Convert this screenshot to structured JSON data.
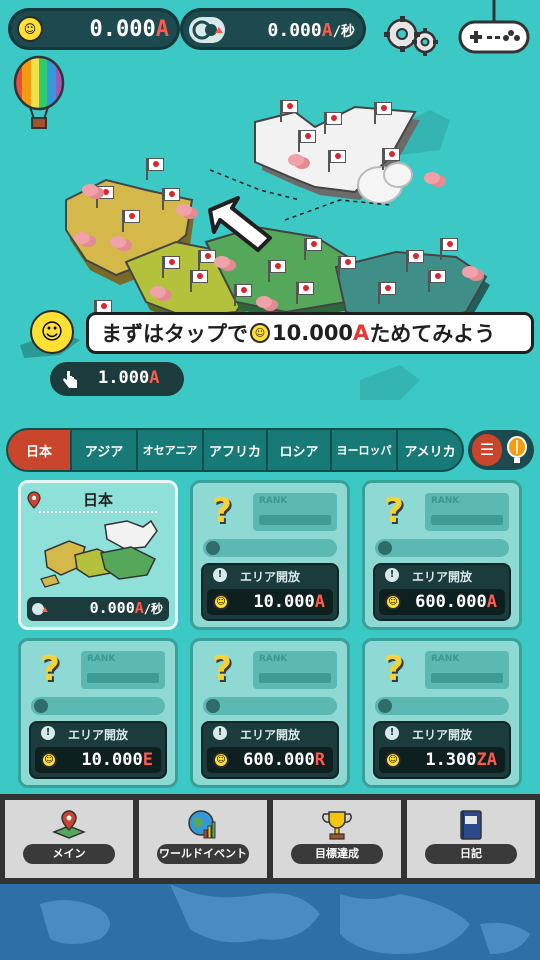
{
  "top_bar": {
    "currency_value": "0.000",
    "currency_unit": "A",
    "rate_value": "0.000",
    "rate_unit": "A",
    "rate_suffix": "/秒"
  },
  "icons": {
    "settings": "gear-icon",
    "gamepad": "gamepad-icon",
    "balloon": "hot-air-balloon-icon",
    "smiley": "smiley-icon"
  },
  "tutorial": {
    "prefix": "まずはタップで",
    "amount": "10.000",
    "amount_unit": "A",
    "suffix": "ためてみよう"
  },
  "tap_value": {
    "value": "1.000",
    "unit": "A"
  },
  "region_tabs": [
    "日本",
    "アジア",
    "オセアニア",
    "アフリカ",
    "ロシア",
    "ヨーロッパ",
    "アメリカ"
  ],
  "active_tab_index": 0,
  "area_cards": [
    {
      "unlocked": true,
      "name": "日本",
      "rate_value": "0.000",
      "rate_unit": "A",
      "rate_suffix": "/秒"
    },
    {
      "unlocked": false,
      "rank_label": "RANK",
      "unlock_label": "エリア開放",
      "cost_value": "10.000",
      "cost_unit": "A"
    },
    {
      "unlocked": false,
      "rank_label": "RANK",
      "unlock_label": "エリア開放",
      "cost_value": "600.000",
      "cost_unit": "A"
    },
    {
      "unlocked": false,
      "rank_label": "RANK",
      "unlock_label": "エリア開放",
      "cost_value": "10.000",
      "cost_unit": "E"
    },
    {
      "unlocked": false,
      "rank_label": "RANK",
      "unlock_label": "エリア開放",
      "cost_value": "600.000",
      "cost_unit": "R"
    },
    {
      "unlocked": false,
      "rank_label": "RANK",
      "unlock_label": "エリア開放",
      "cost_value": "1.300",
      "cost_unit": "ZA"
    }
  ],
  "bottom_nav": [
    {
      "label": "メイン",
      "icon": "map-pin-icon"
    },
    {
      "label": "ワールドイベント",
      "icon": "globe-chart-icon"
    },
    {
      "label": "目標達成",
      "icon": "trophy-icon"
    },
    {
      "label": "日記",
      "icon": "diary-icon"
    }
  ],
  "colors": {
    "sea": "#3cc8c4",
    "accent_red": "#ff5a4a",
    "tab_active": "#c9452b",
    "tab": "#187a77",
    "coin": "#ffe033"
  }
}
